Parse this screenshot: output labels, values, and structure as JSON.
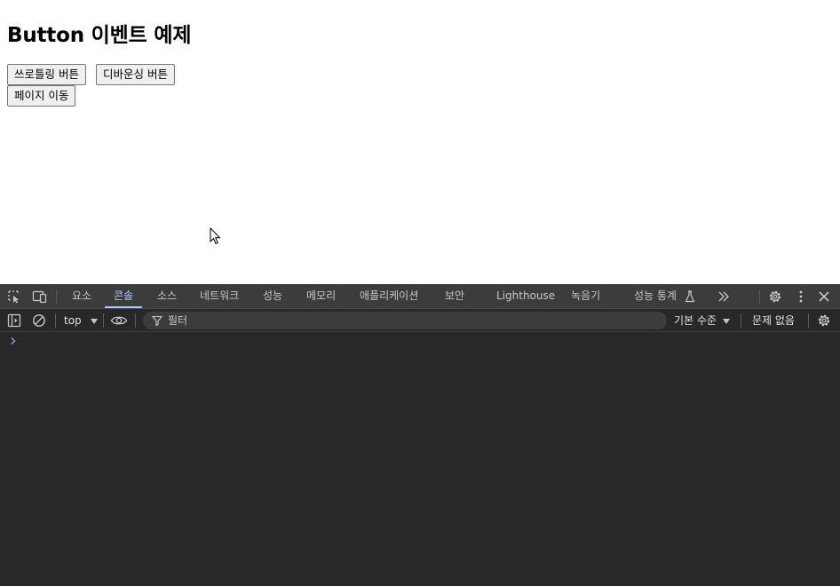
{
  "page": {
    "heading": "Button 이벤트 예제",
    "buttons": {
      "throttle": "쓰로틀링 버튼",
      "debounce": "디바운싱 버튼",
      "navigate": "페이지 이동"
    }
  },
  "devtools": {
    "tabs": {
      "elements": "요소",
      "console": "콘솔",
      "sources": "소스",
      "network": "네트워크",
      "performance": "성능",
      "memory": "메모리",
      "application": "애플리케이션",
      "security": "보안",
      "lighthouse": "Lighthouse",
      "recorder": "녹음기",
      "perf_insights": "성능 통계"
    },
    "active_tab": "콘솔",
    "toolbar": {
      "context": "top",
      "filter_placeholder": "필터",
      "log_levels": "기본 수준",
      "issues": "문제 없음"
    },
    "icons": {
      "inspect": "inspect-element-icon",
      "device": "device-toolbar-icon",
      "flask": "flask-icon",
      "more_tabs": "more-tabs-icon",
      "settings": "gear-icon",
      "kebab": "kebab-menu-icon",
      "close": "close-icon",
      "sidebar": "sidebar-toggle-icon",
      "clear": "clear-console-icon",
      "eye": "eye-icon",
      "funnel": "filter-funnel-icon",
      "console_settings": "gear-icon",
      "prompt": "chevron-right-icon"
    },
    "colors": {
      "panel_bg": "#282828",
      "tabbar_bg": "#3c3c3c",
      "text": "#c7c7c7",
      "accent": "#a8c7fa"
    }
  }
}
